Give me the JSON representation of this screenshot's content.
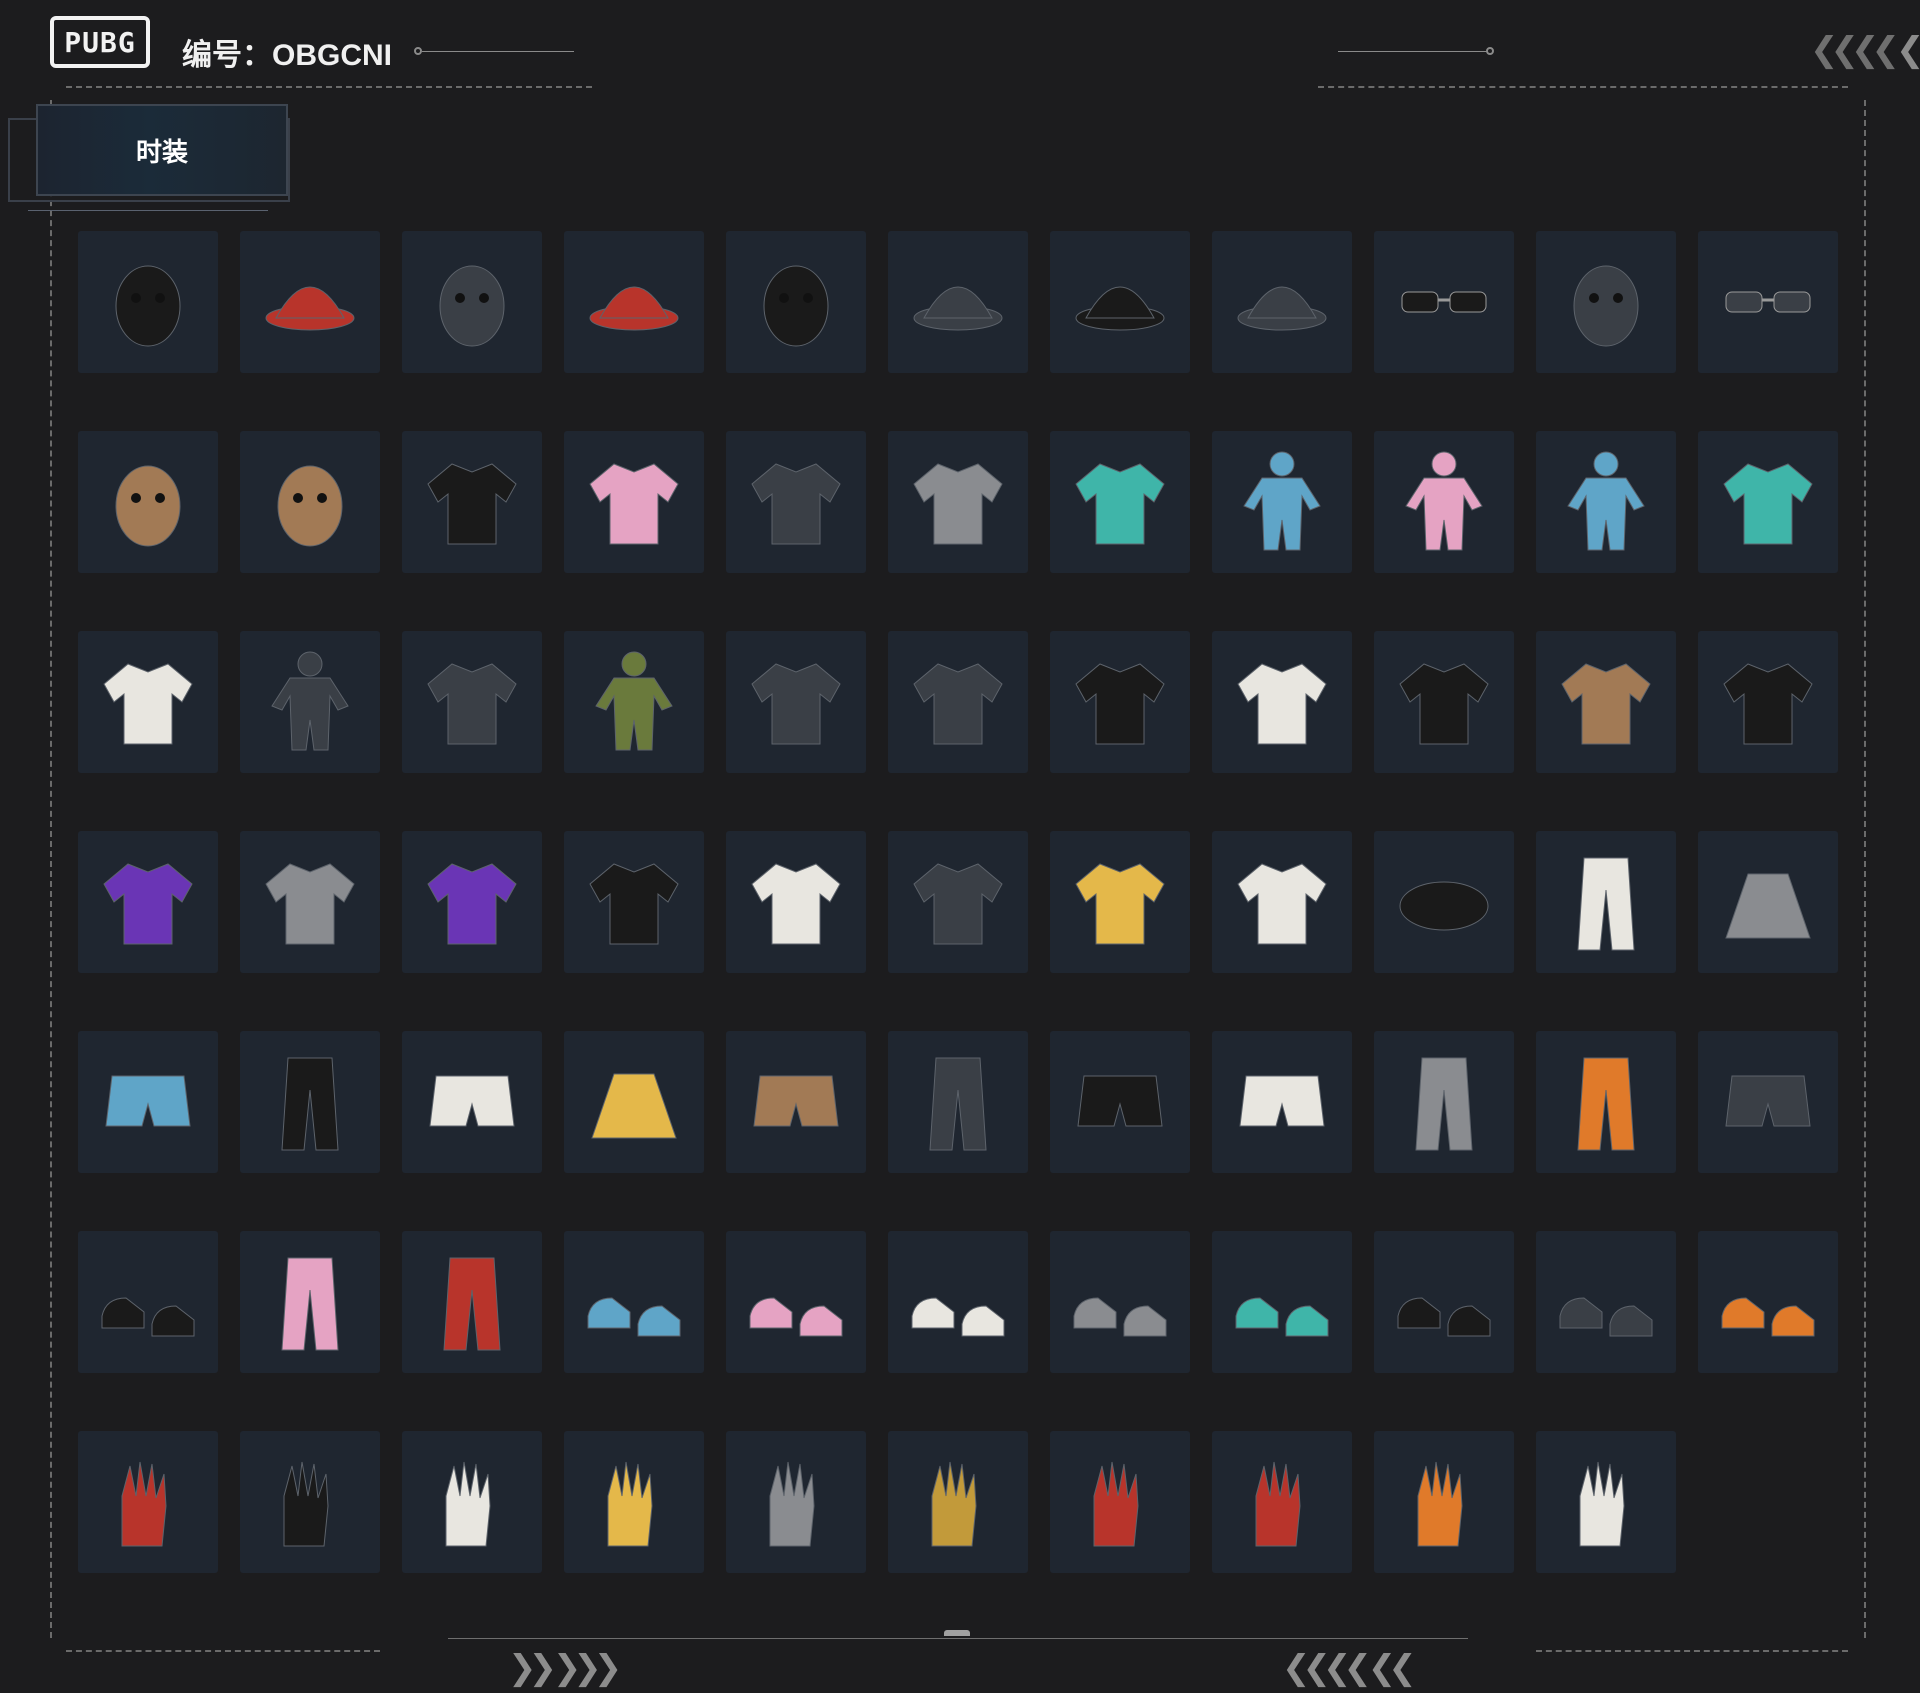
{
  "header": {
    "logo_text": "PUBG",
    "title": "编号：OBGCNI"
  },
  "tabs": [
    {
      "label": "时装",
      "active": true
    }
  ],
  "colors": {
    "background": "#1c1c1e",
    "tile": "#1f2630",
    "accent_line": "#8a8a8a",
    "tab_bg": "#1b2b39"
  },
  "items": [
    {
      "icon": "bunny-mask-icon"
    },
    {
      "icon": "checkered-visor-icon"
    },
    {
      "icon": "dinosaur-head-icon"
    },
    {
      "icon": "red-witch-hat-icon"
    },
    {
      "icon": "cat-ears-icon"
    },
    {
      "icon": "knit-beanie-icon"
    },
    {
      "icon": "black-cap-icon"
    },
    {
      "icon": "bucket-hat-icon"
    },
    {
      "icon": "black-sunglasses-icon"
    },
    {
      "icon": "plush-mask-icon"
    },
    {
      "icon": "shutter-shades-icon"
    },
    {
      "icon": "bearded-head-icon"
    },
    {
      "icon": "wooden-mask-icon"
    },
    {
      "icon": "black-top-icon"
    },
    {
      "icon": "pink-dress-icon"
    },
    {
      "icon": "graphic-tshirt-icon"
    },
    {
      "icon": "grey-tshirt-icon"
    },
    {
      "icon": "teal-bikini-icon"
    },
    {
      "icon": "blue-onesie-icon"
    },
    {
      "icon": "pink-onesie-icon"
    },
    {
      "icon": "blue-jumpsuit-icon"
    },
    {
      "icon": "mint-tube-top-icon"
    },
    {
      "icon": "white-tube-top-icon"
    },
    {
      "icon": "jester-outfit-icon"
    },
    {
      "icon": "sport-top-icon"
    },
    {
      "icon": "green-flight-suit-icon"
    },
    {
      "icon": "mesh-top-icon"
    },
    {
      "icon": "floral-shirt-icon"
    },
    {
      "icon": "cropped-leather-jacket-icon"
    },
    {
      "icon": "white-hoodie-icon"
    },
    {
      "icon": "leather-jacket-icon"
    },
    {
      "icon": "bear-coat-icon"
    },
    {
      "icon": "puffer-vest-icon"
    },
    {
      "icon": "purple-varsity-jacket-icon"
    },
    {
      "icon": "grey-orange-jacket-icon"
    },
    {
      "icon": "purple-team-jacket-icon"
    },
    {
      "icon": "black-hoodie-icon"
    },
    {
      "icon": "white-orange-jacket-icon"
    },
    {
      "icon": "gradient-hoodie-icon"
    },
    {
      "icon": "yellow-puffer-vest-icon"
    },
    {
      "icon": "green-white-hoodie-icon"
    },
    {
      "icon": "black-fanny-pack-icon"
    },
    {
      "icon": "cream-pants-icon"
    },
    {
      "icon": "plaid-skirt-icon"
    },
    {
      "icon": "denim-shorts-icon"
    },
    {
      "icon": "black-cargo-pants-icon"
    },
    {
      "icon": "white-bloomers-icon"
    },
    {
      "icon": "yellow-skirt-icon"
    },
    {
      "icon": "brown-shorts-icon"
    },
    {
      "icon": "ripped-jeans-icon"
    },
    {
      "icon": "black-denim-shorts-icon"
    },
    {
      "icon": "white-shorts-icon"
    },
    {
      "icon": "camo-pants-icon"
    },
    {
      "icon": "orange-pants-icon"
    },
    {
      "icon": "gradient-shorts-icon"
    },
    {
      "icon": "black-boots-icon"
    },
    {
      "icon": "pink-stockings-icon"
    },
    {
      "icon": "checkered-socks-icon"
    },
    {
      "icon": "blue-shark-slippers-icon"
    },
    {
      "icon": "pink-shark-slippers-icon"
    },
    {
      "icon": "white-sneakers-icon"
    },
    {
      "icon": "grey-orange-sneakers-icon"
    },
    {
      "icon": "teal-clogs-icon"
    },
    {
      "icon": "black-sneakers-icon"
    },
    {
      "icon": "fur-boots-icon"
    },
    {
      "icon": "orange-hiking-shoes-icon"
    },
    {
      "icon": "red-mech-gloves-icon"
    },
    {
      "icon": "black-claw-gloves-icon"
    },
    {
      "icon": "white-hand-nails-icon"
    },
    {
      "icon": "yellow-gloves-icon"
    },
    {
      "icon": "grey-hand-ring-icon"
    },
    {
      "icon": "gold-claw-gloves-icon"
    },
    {
      "icon": "armored-gauntlet-icon"
    },
    {
      "icon": "red-racing-gloves-icon"
    },
    {
      "icon": "orange-moto-gloves-icon"
    },
    {
      "icon": "yellow-white-gloves-icon"
    }
  ]
}
